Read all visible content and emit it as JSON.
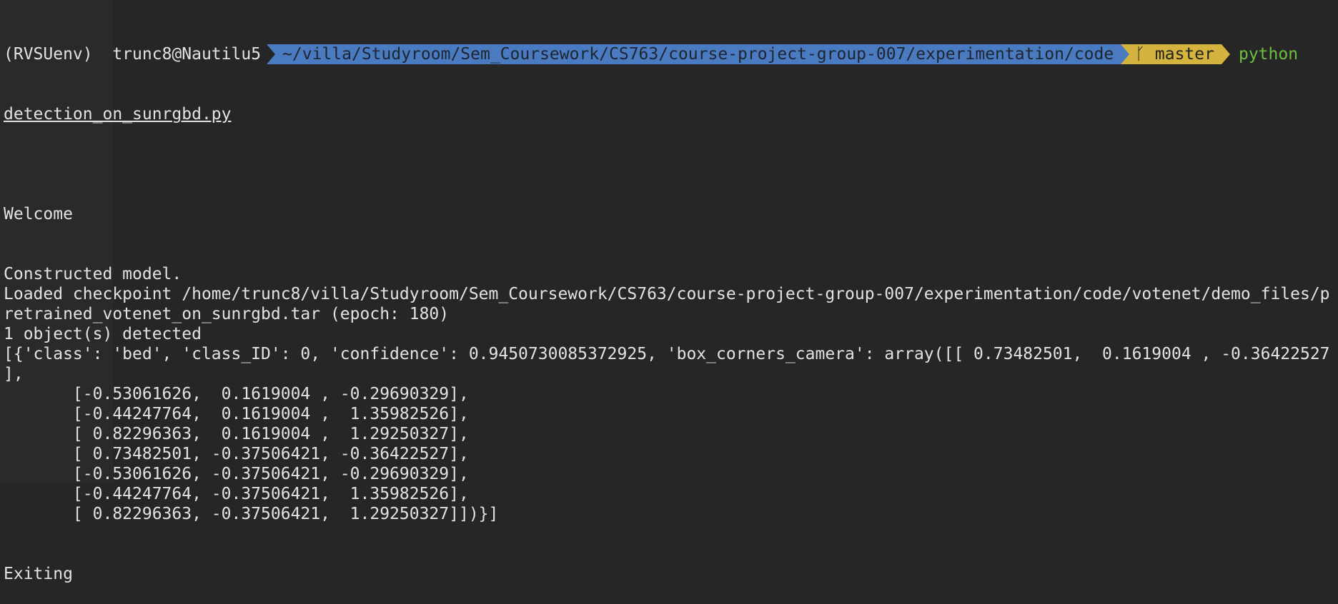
{
  "prompt": {
    "env": "(RVSUenv)",
    "user_host": "trunc8@Nautilu5",
    "path": "~/villa/Studyroom/Sem_Coursework/CS763/course-project-group-007/experimentation/code",
    "branch_icon": "git-branch-icon",
    "branch": "master",
    "command_start": "python",
    "command_wrap": "detection_on_sunrgbd.py"
  },
  "colors": {
    "path_segment": "#4a7bc0",
    "git_segment": "#d4b43e",
    "command": "#6cc040",
    "background": "#262626"
  },
  "output": [
    "",
    "",
    "Welcome",
    "",
    "",
    "Constructed model.",
    "Loaded checkpoint /home/trunc8/villa/Studyroom/Sem_Coursework/CS763/course-project-group-007/experimentation/code/votenet/demo_files/p",
    "retrained_votenet_on_sunrgbd.tar (epoch: 180)",
    "1 object(s) detected",
    "[{'class': 'bed', 'class_ID': 0, 'confidence': 0.9450730085372925, 'box_corners_camera': array([[ 0.73482501,  0.1619004 , -0.36422527",
    "],",
    "       [-0.53061626,  0.1619004 , -0.29690329],",
    "       [-0.44247764,  0.1619004 ,  1.35982526],",
    "       [ 0.82296363,  0.1619004 ,  1.29250327],",
    "       [ 0.73482501, -0.37506421, -0.36422527],",
    "       [-0.53061626, -0.37506421, -0.29690329],",
    "       [-0.44247764, -0.37506421,  1.35982526],",
    "       [ 0.82296363, -0.37506421,  1.29250327]])}]",
    "",
    "",
    "Exiting"
  ]
}
